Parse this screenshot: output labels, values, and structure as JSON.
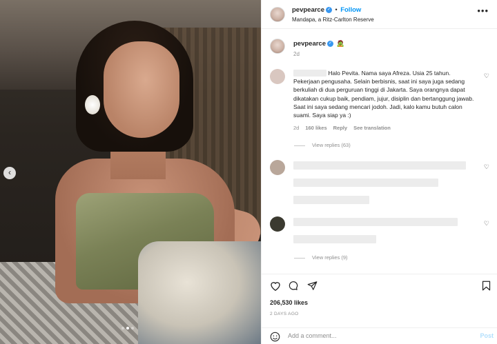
{
  "post": {
    "username": "pevpearce",
    "follow_label": "Follow",
    "separator": "•",
    "location": "Mandapa, a Ritz-Carlton Reserve",
    "more_icon": "more-horizontal-icon",
    "carousel_prev_icon": "chevron-left-icon",
    "carousel_dots": 3,
    "carousel_active_index": 1
  },
  "caption": {
    "username": "pevpearce",
    "emoji": "🧟",
    "age": "2d"
  },
  "comments": [
    {
      "text": "Halo Pevita. Nama saya Afreza. Usia 25 tahun. Pekerjaan pengusaha. Selain berbisnis, saat ini saya juga sedang berkuliah di dua perguruan tinggi di Jakarta. Saya orangnya dapat dikatakan cukup baik, pendiam, jujur, disiplin dan bertanggung jawab. Saat ini saya sedang mencari jodoh. Jadi, kalo kamu butuh calon suami. Saya siap ya :)",
      "age": "2d",
      "likes": "160 likes",
      "reply_label": "Reply",
      "translation_label": "See translation",
      "view_replies": "View replies (63)"
    },
    {
      "view_replies": null
    },
    {
      "view_replies": "View replies (9)"
    }
  ],
  "actions": {
    "like_icon": "heart-icon",
    "comment_icon": "comment-icon",
    "share_icon": "send-icon",
    "save_icon": "bookmark-icon"
  },
  "likes": "206,530 likes",
  "timestamp": "2 DAYS AGO",
  "add_comment": {
    "placeholder": "Add a comment...",
    "post_label": "Post",
    "emoji_icon": "smiley-icon"
  },
  "colors": {
    "accent": "#0095f6",
    "verified": "#3897f0"
  }
}
